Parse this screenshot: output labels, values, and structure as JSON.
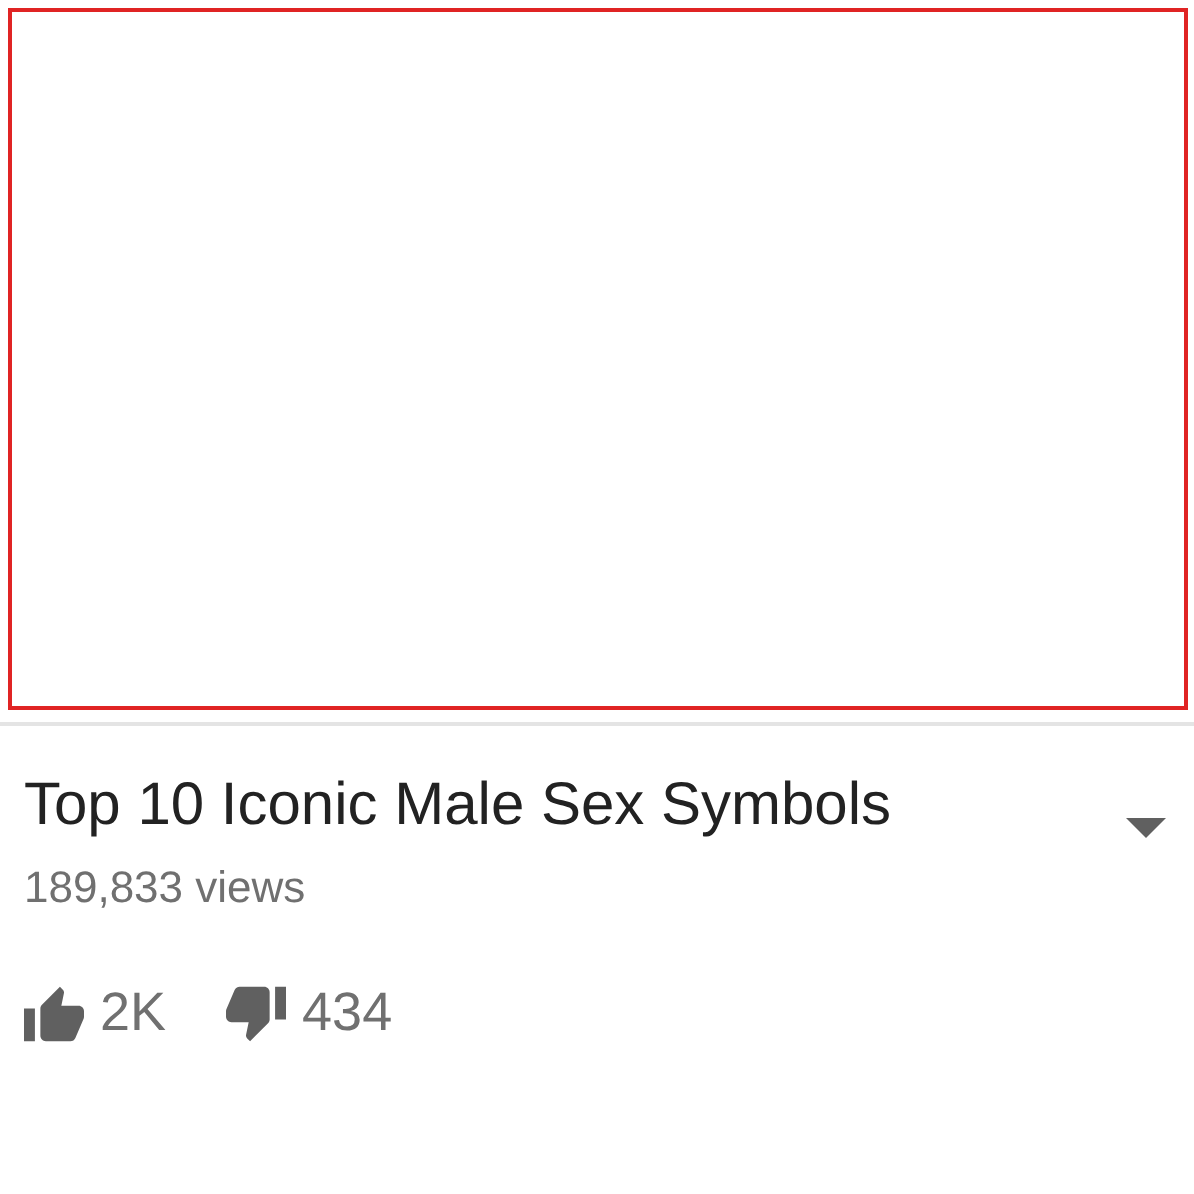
{
  "video": {
    "title": "Top 10 Iconic Male Sex Symbols",
    "views": "189,833 views",
    "likes": "2K",
    "dislikes": "434"
  }
}
